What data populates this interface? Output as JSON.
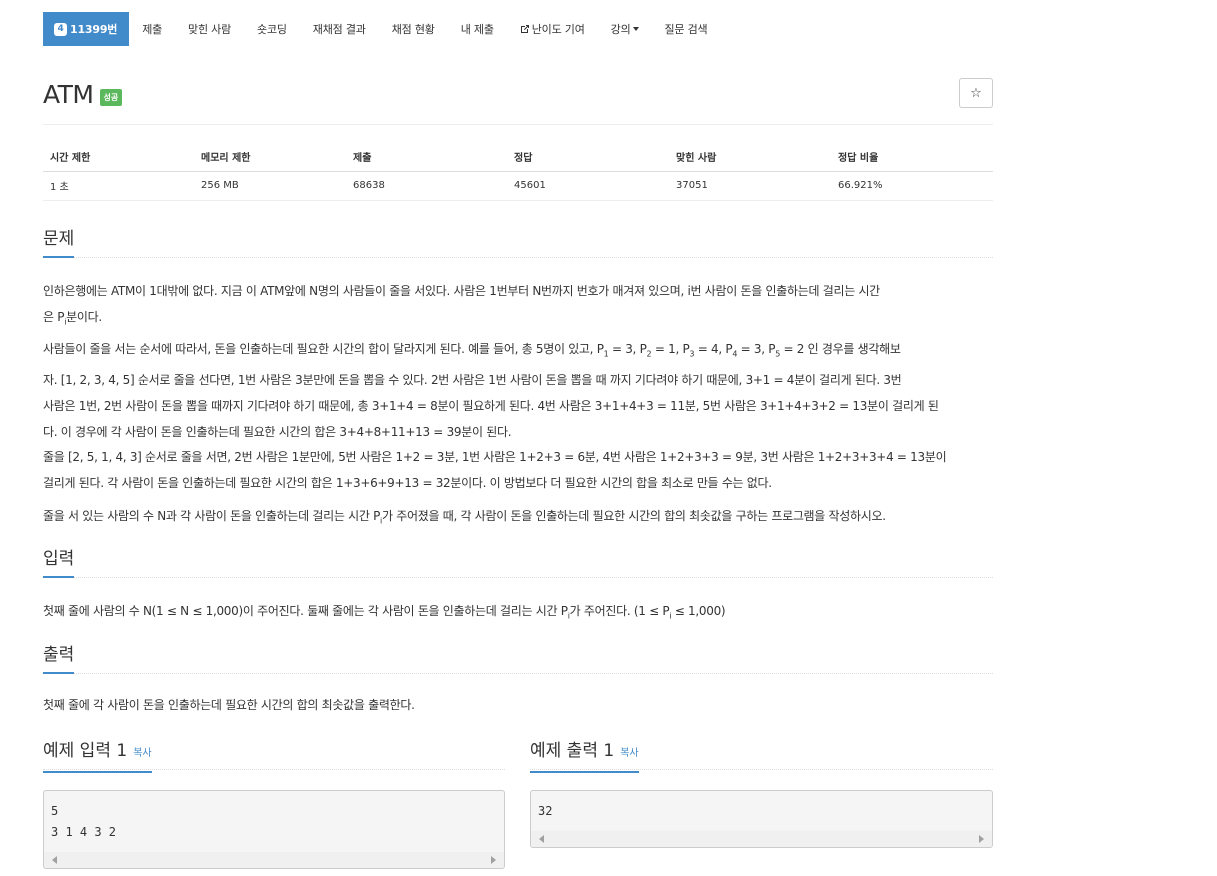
{
  "nav": {
    "problem_number_badge": "4",
    "problem_number": "11399번",
    "items": [
      "제출",
      "맞힌 사람",
      "숏코딩",
      "재채점 결과",
      "채점 현황",
      "내 제출",
      "난이도 기여",
      "강의",
      "질문 검색"
    ],
    "icons": [
      "badge-icon",
      "external-link-icon",
      "caret-down-icon"
    ]
  },
  "problem": {
    "title": "ATM",
    "status": "성공",
    "star_icon": "star-icon"
  },
  "info": {
    "headers": [
      "시간 제한",
      "메모리 제한",
      "제출",
      "정답",
      "맞힌 사람",
      "정답 비율"
    ],
    "values": [
      "1 초",
      "256 MB",
      "68638",
      "45601",
      "37051",
      "66.921%"
    ]
  },
  "sections": {
    "problem_title": "문제",
    "input_title": "입력",
    "output_title": "출력"
  },
  "description": {
    "p1a": "인하은행에는 ATM이 1대밖에 없다. 지금 이 ATM앞에 N명의 사람들이 줄을 서있다. 사람은 1번부터 N번까지 번호가 매겨져 있으며, i번 사람이 돈을 인출하는데 걸리는 시간",
    "p1b": "은 P",
    "p1c": "분이다.",
    "p2a": "사람들이 줄을 서는 순서에 따라서, 돈을 인출하는데 필요한 시간의 합이 달라지게 된다. 예를 들어, 총 5명이 있고, P",
    "p2b": "자. [1, 2, 3, 4, 5] 순서로 줄을 선다면, 1번 사람은 3분만에 돈을 뽑을 수 있다. 2번 사람은 1번 사람이 돈을 뽑을 때 까지 기다려야 하기 때문에, 3+1 = 4분이 걸리게 된다. 3번",
    "p2c": "사람은 1번, 2번 사람이 돈을 뽑을 때까지 기다려야 하기 때문에, 총 3+1+4 = 8분이 필요하게 된다. 4번 사람은 3+1+4+3 = 11분, 5번 사람은 3+1+4+3+2 = 13분이 걸리게 된",
    "p2d": "다. 이 경우에 각 사람이 돈을 인출하는데 필요한 시간의 합은 3+4+8+11+13 = 39분이 된다.",
    "p3a": "줄을 [2, 5, 1, 4, 3] 순서로 줄을 서면, 2번 사람은 1분만에, 5번 사람은 1+2 = 3분, 1번 사람은 1+2+3 = 6분, 4번 사람은 1+2+3+3 = 9분, 3번 사람은 1+2+3+3+4 = 13분이",
    "p3b": "걸리게 된다. 각 사람이 돈을 인출하는데 필요한 시간의 합은 1+3+6+9+13 = 32분이다. 이 방법보다 더 필요한 시간의 합을 최소로 만들 수는 없다.",
    "p4a": "줄을 서 있는 사람의 수 N과 각 사람이 돈을 인출하는데 걸리는 시간 P",
    "p4b": "가 주어졌을 때, 각 사람이 돈을 인출하는데 필요한 시간의 합의 최솟값을 구하는 프로그램을 작성하시오.",
    "sub_i": "i",
    "assignments": [
      {
        "var": "P",
        "sub": "1",
        "val": " = 3, "
      },
      {
        "var": "P",
        "sub": "2",
        "val": " = 1, "
      },
      {
        "var": "P",
        "sub": "3",
        "val": " = 4, "
      },
      {
        "var": "P",
        "sub": "4",
        "val": " = 3, "
      },
      {
        "var": "P",
        "sub": "5",
        "val": " = 2 인 경우를 생각해보"
      }
    ]
  },
  "input_desc": {
    "a": "첫째 줄에 사람의 수 N(1 ≤ N ≤ 1,000)이 주어진다. 둘째 줄에는 각 사람이 돈을 인출하는데 걸리는 시간 P",
    "b": "가 주어진다. (1 ≤ P",
    "c": " ≤ 1,000)"
  },
  "output_desc": "첫째 줄에 각 사람이 돈을 인출하는데 필요한 시간의 합의 최솟값을 출력한다.",
  "samples": {
    "input_title": "예제 입력 1",
    "output_title": "예제 출력 1",
    "copy_label": "복사",
    "input_text": "5\n3 1 4 3 2",
    "output_text": "32"
  }
}
